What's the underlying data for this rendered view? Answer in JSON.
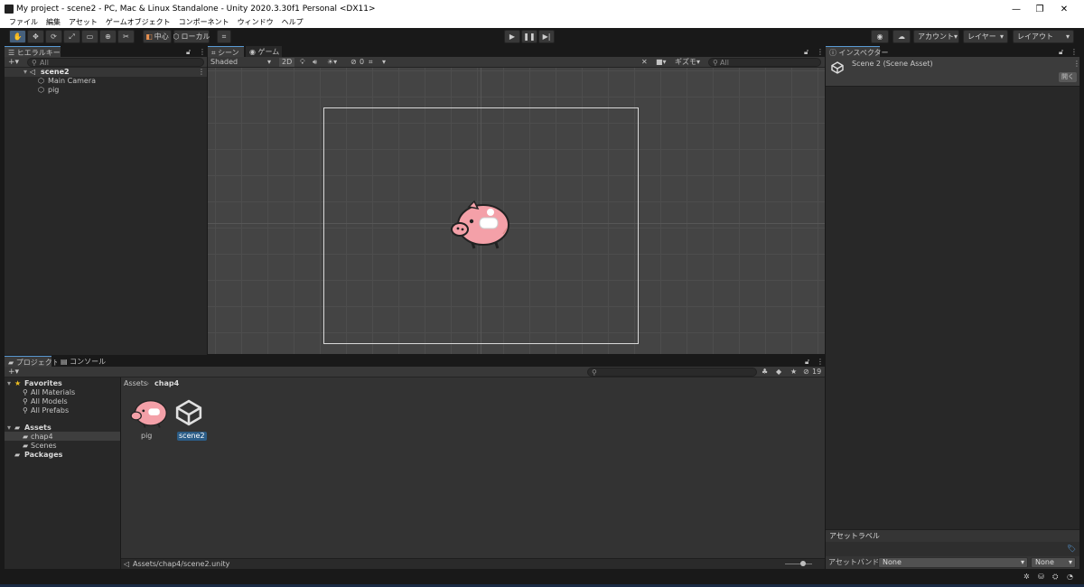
{
  "window": {
    "title": "My project - scene2 - PC, Mac & Linux Standalone - Unity 2020.3.30f1 Personal <DX11>",
    "minimize": "—",
    "maximize": "❐",
    "close": "✕"
  },
  "menu": [
    "ファイル",
    "編集",
    "アセット",
    "ゲームオブジェクト",
    "コンポーネント",
    "ウィンドウ",
    "ヘルプ"
  ],
  "toolbar": {
    "pivot": "中心",
    "space": "ローカル",
    "account": "アカウント",
    "layers": "レイヤー",
    "layout": "レイアウト"
  },
  "hierarchy": {
    "tab": "ヒエラルキー",
    "add": "+▾",
    "search_placeholder": "All",
    "scene": "scene2",
    "items": [
      "Main Camera",
      "pig"
    ]
  },
  "scene_view": {
    "tabs": [
      "シーン",
      "ゲーム"
    ],
    "shading": "Shaded",
    "mode_2d": "2D",
    "hidden_count": "0",
    "gizmos": "ギズモ",
    "search_placeholder": "All"
  },
  "inspector": {
    "tab": "インスペクター",
    "title": "Scene 2 (Scene Asset)",
    "open_button": "開く",
    "asset_labels": "アセットラベル",
    "asset_bundle_label": "アセットバンドル",
    "bundle_value": "None",
    "variant_value": "None"
  },
  "project": {
    "tabs": [
      "プロジェクト",
      "コンソール"
    ],
    "add": "+▾",
    "favorites": "Favorites",
    "favorite_items": [
      "All Materials",
      "All Models",
      "All Prefabs"
    ],
    "assets": "Assets",
    "asset_folders": [
      "chap4",
      "Scenes"
    ],
    "packages": "Packages",
    "breadcrumb": [
      "Assets",
      "chap4"
    ],
    "hidden_count": "19",
    "files": [
      "pig",
      "scene2"
    ],
    "footer_path": "Assets/chap4/scene2.unity"
  },
  "colors": {
    "accent": "#2c5d87",
    "selection": "#3e5f96",
    "pig": "#f4a0a8"
  }
}
